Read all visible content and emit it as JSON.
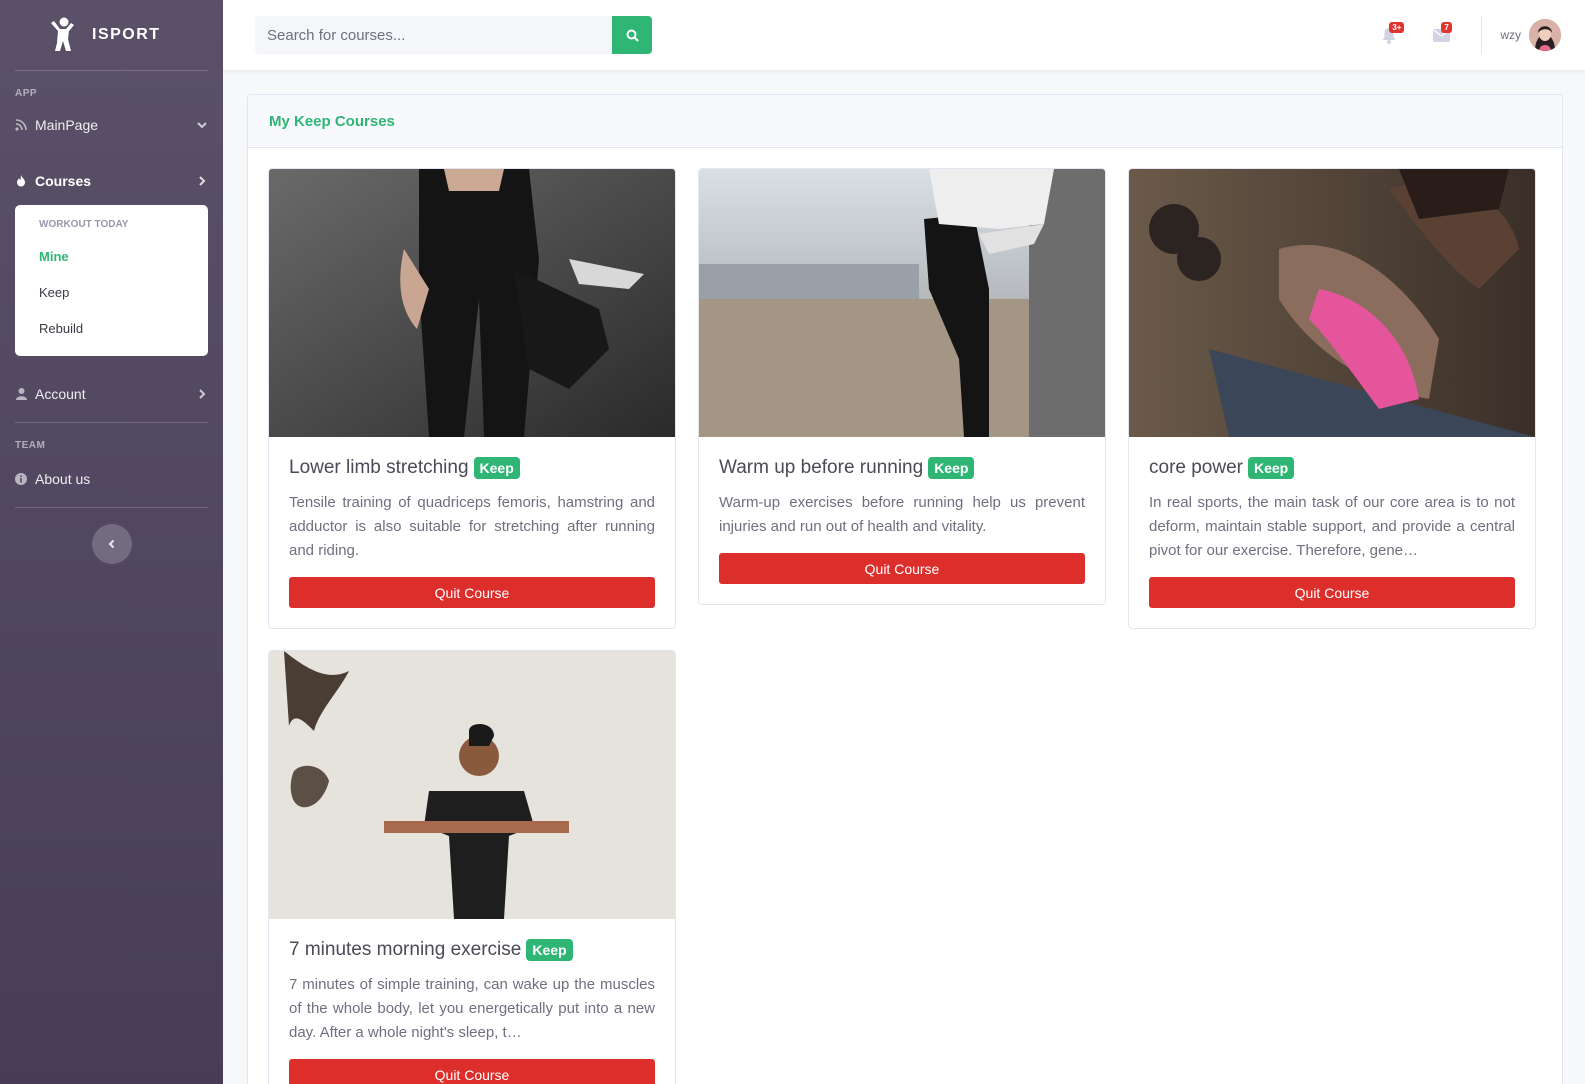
{
  "brand": {
    "name": "ISPORT"
  },
  "sidebar": {
    "app_heading": "APP",
    "mainpage_label": "MainPage",
    "courses_label": "Courses",
    "submenu": {
      "heading": "WORKOUT TODAY",
      "items": [
        {
          "label": "Mine",
          "active": true
        },
        {
          "label": "Keep",
          "active": false
        },
        {
          "label": "Rebuild",
          "active": false
        }
      ]
    },
    "account_label": "Account",
    "team_heading": "TEAM",
    "about_label": "About us"
  },
  "topbar": {
    "search_placeholder": "Search for courses...",
    "alerts_count": "3+",
    "messages_count": "7",
    "username": "wzy"
  },
  "main": {
    "title": "My Keep Courses",
    "courses": [
      {
        "title": "Lower limb stretching",
        "tag": "Keep",
        "description": "Tensile training of quadriceps femoris, hamstring and adductor is also suitable for stretching after running and riding.",
        "button": "Quit Course"
      },
      {
        "title": "Warm up before running",
        "tag": "Keep",
        "description": "Warm-up exercises before running help us prevent injuries and run out of health and vitality.",
        "button": "Quit Course"
      },
      {
        "title": "core power",
        "tag": "Keep",
        "description": "In real sports, the main task of our core area is to not deform, maintain stable support, and provide a central pivot for our exercise. Therefore, gene…",
        "button": "Quit Course"
      },
      {
        "title": "7 minutes morning exercise",
        "tag": "Keep",
        "description": "7 minutes of simple training, can wake up the muscles of the whole body, let you energetically put into a new day. After a whole night's sleep, t…",
        "button": "Quit Course"
      }
    ]
  },
  "colors": {
    "accent": "#2fb574",
    "danger": "#dc2f2c",
    "sidebar_top": "#5a5169",
    "sidebar_bottom": "#473d57"
  }
}
